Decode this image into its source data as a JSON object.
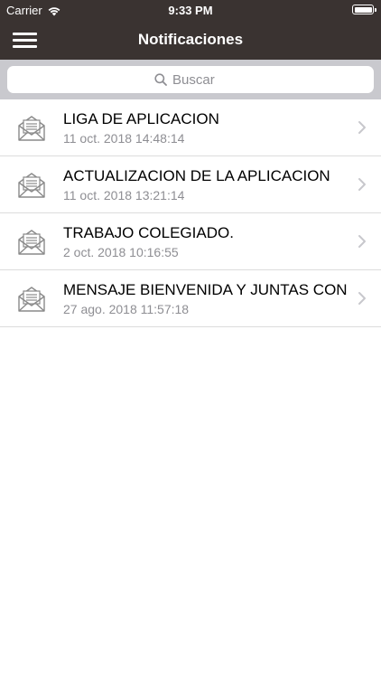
{
  "status_bar": {
    "carrier": "Carrier",
    "time": "9:33 PM"
  },
  "navbar": {
    "title": "Notificaciones",
    "menu_icon": "hamburger-menu-icon"
  },
  "search": {
    "placeholder": "Buscar"
  },
  "notifications": [
    {
      "title": "LIGA DE APLICACION",
      "date": "11 oct. 2018 14:48:14"
    },
    {
      "title": "ACTUALIZACION DE LA APLICACION",
      "date": "11 oct. 2018 13:21:14"
    },
    {
      "title": "TRABAJO COLEGIADO.",
      "date": "2 oct. 2018 10:16:55"
    },
    {
      "title": "MENSAJE BIENVENIDA Y JUNTAS CON",
      "date": "27 ago. 2018 11:57:18"
    }
  ],
  "colors": {
    "nav_background": "#3a3331",
    "search_background": "#c9c9ce",
    "secondary_text": "#8e8e93"
  }
}
